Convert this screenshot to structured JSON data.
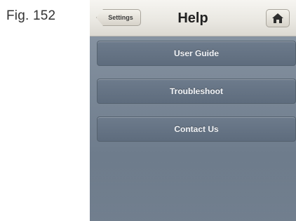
{
  "figure": {
    "caption": "Fig. 152"
  },
  "navbar": {
    "back_label": "Settings",
    "title": "Help",
    "home_icon": "home-icon"
  },
  "menu": {
    "items": [
      {
        "label": "User Guide"
      },
      {
        "label": "Troubleshoot"
      },
      {
        "label": "Contact Us"
      }
    ]
  },
  "colors": {
    "navbar_bg": "#ebe9e3",
    "content_bg": "#7d8a99",
    "menu_item_bg": "#66748a",
    "menu_text": "#f2f4f7"
  }
}
